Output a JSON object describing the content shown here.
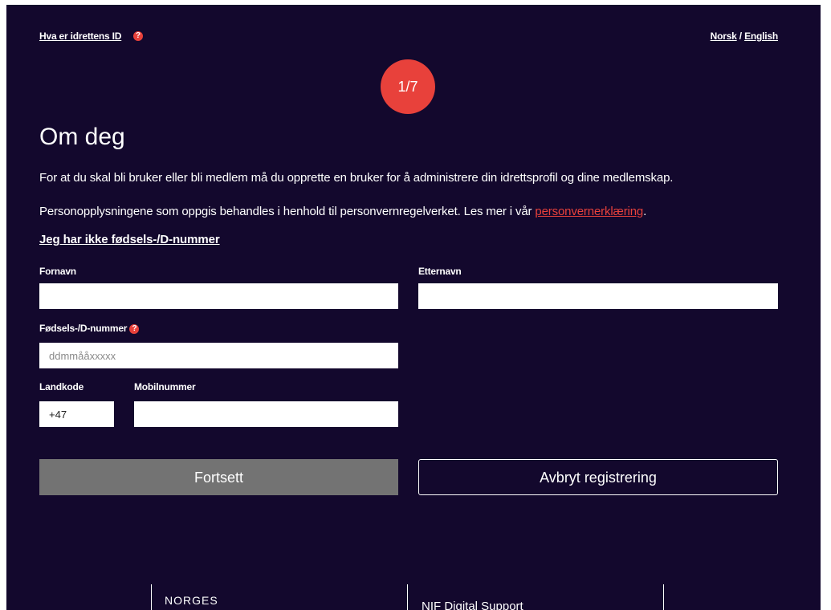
{
  "header": {
    "about_link": "Hva er idrettens ID",
    "help_symbol": "?",
    "lang_norsk": "Norsk",
    "lang_sep": " / ",
    "lang_english": "English"
  },
  "step": "1/7",
  "title": "Om deg",
  "intro_text": "For at du skal bli bruker eller bli medlem må du opprette en bruker for å administrere din idrettsprofil og dine medlemskap.",
  "privacy": {
    "text": "Personopplysningene som oppgis behandles i henhold til personvernregelverket. Les mer i vår ",
    "link": "personvernerklæring",
    "suffix": "."
  },
  "no_birth_number_link": "Jeg har ikke fødsels-/D-nummer",
  "form": {
    "first_name_label": "Fornavn",
    "first_name_value": "",
    "last_name_label": "Etternavn",
    "last_name_value": "",
    "birth_number_label": "Fødsels-/D-nummer",
    "birth_number_placeholder": "ddmmååxxxxx",
    "country_code_label": "Landkode",
    "country_code_value": "+47",
    "mobile_label": "Mobilnummer",
    "mobile_value": ""
  },
  "buttons": {
    "continue": "Fortsett",
    "cancel": "Avbryt registrering"
  },
  "footer": {
    "org_name": "NORGES",
    "support_title": "NIF Digital Support"
  },
  "colors": {
    "background": "#13082d",
    "accent": "#e8413b",
    "button_disabled": "#737373"
  },
  "icons": [
    "question-circle-icon"
  ]
}
